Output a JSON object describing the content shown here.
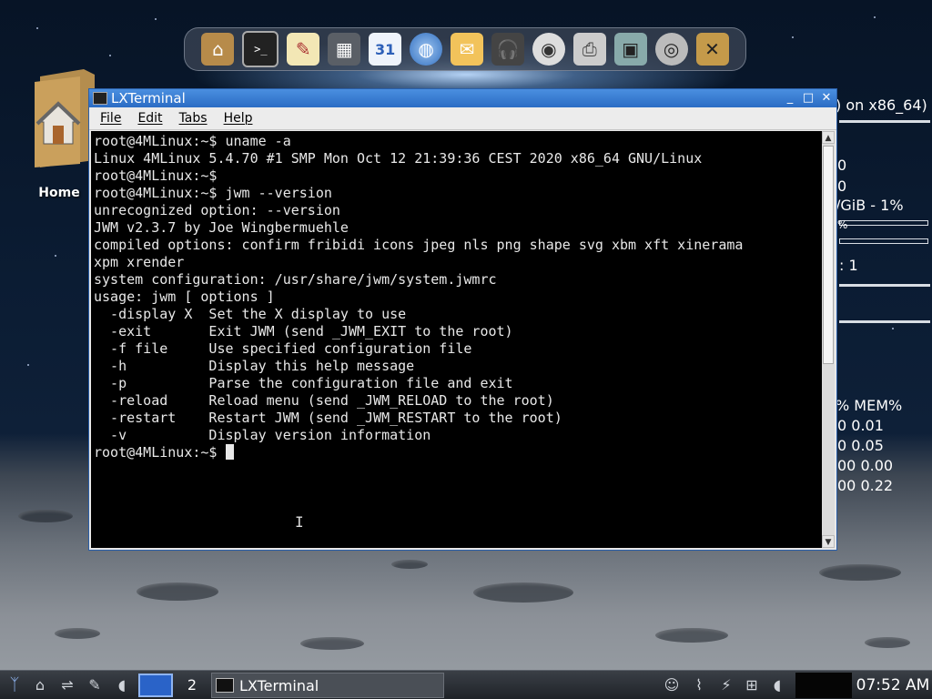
{
  "window": {
    "title": "LXTerminal",
    "controls": {
      "minimize": "_",
      "maximize": "□",
      "close": "✕"
    }
  },
  "menubar": {
    "items": [
      {
        "label": "File"
      },
      {
        "label": "Edit"
      },
      {
        "label": "Tabs"
      },
      {
        "label": "Help"
      }
    ]
  },
  "terminal": {
    "lines": [
      "root@4MLinux:~$ uname -a",
      "Linux 4MLinux 5.4.70 #1 SMP Mon Oct 12 21:39:36 CEST 2020 x86_64 GNU/Linux",
      "root@4MLinux:~$",
      "root@4MLinux:~$ jwm --version",
      "unrecognized option: --version",
      "JWM v2.3.7 by Joe Wingbermuehle",
      "compiled options: confirm fribidi icons jpeg nls png shape svg xbm xft xinerama",
      "xpm xrender",
      "system configuration: /usr/share/jwm/system.jwmrc",
      "usage: jwm [ options ]",
      "  -display X  Set the X display to use",
      "  -exit       Exit JWM (send _JWM_EXIT to the root)",
      "  -f file     Use specified configuration file",
      "  -h          Display this help message",
      "  -p          Parse the configuration file and exit",
      "  -reload     Reload menu (send _JWM_RELOAD to the root)",
      "  -restart    Restart JWM (send _JWM_RESTART to the root)",
      "  -v          Display version information"
    ],
    "prompt": "root@4MLinux:~$ "
  },
  "desktop": {
    "home_label": "Home",
    "conky": {
      "system": ") on x86_64)",
      "line_a": "0",
      "line_b": "0",
      "disk": "/GiB - 1%",
      "misc": "%",
      "procs": ": 1",
      "proc_header": "%   MEM%",
      "proc_rows": [
        "0  0.01",
        "0  0.05",
        "00  0.00",
        "00  0.22"
      ]
    }
  },
  "dock": {
    "icons": [
      "home-icon",
      "terminal-icon",
      "text-editor-icon",
      "calculator-icon",
      "calendar-icon",
      "browser-icon",
      "mail-icon",
      "headphones-icon",
      "video-reel-icon",
      "printer-icon",
      "camcorder-icon",
      "webcam-icon",
      "tools-icon"
    ],
    "calendar_day": "31"
  },
  "taskbar": {
    "workspace_2": "2",
    "task_label": "LXTerminal",
    "clock": "07:52 AM"
  },
  "colors": {
    "titlebar": "#2b6cc4",
    "terminal_bg": "#000000",
    "terminal_fg": "#e8e8e8",
    "workspace_active": "#2a63c8"
  }
}
